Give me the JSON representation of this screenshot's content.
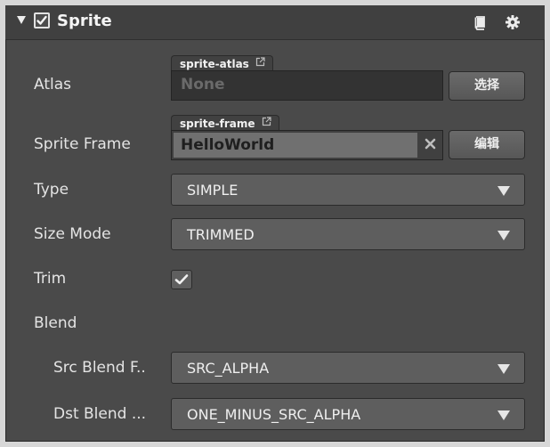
{
  "component": {
    "title": "Sprite",
    "enabled": true,
    "icons": {
      "fold": "triangle-down-icon",
      "help": "book-icon",
      "settings": "gear-icon"
    }
  },
  "properties": {
    "atlas": {
      "label": "Atlas",
      "asset_type": "sprite-atlas",
      "placeholder": "None",
      "button_label": "选择"
    },
    "sprite_frame": {
      "label": "Sprite Frame",
      "asset_type": "sprite-frame",
      "value": "HelloWorld",
      "button_label": "编辑"
    },
    "type": {
      "label": "Type",
      "value": "SIMPLE"
    },
    "size_mode": {
      "label": "Size Mode",
      "value": "TRIMMED"
    },
    "trim": {
      "label": "Trim",
      "checked": true
    },
    "blend": {
      "label": "Blend",
      "src": {
        "label": "Src Blend F..",
        "value": "SRC_ALPHA"
      },
      "dst": {
        "label": "Dst Blend ...",
        "value": "ONE_MINUS_SRC_ALPHA"
      }
    }
  },
  "colors": {
    "panel_bg": "#4a4a4a",
    "header_bg": "#404040",
    "text": "#e4e4e4"
  }
}
